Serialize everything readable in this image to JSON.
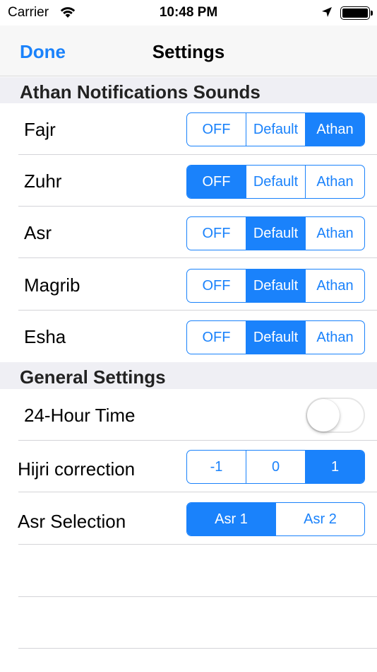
{
  "status_bar": {
    "carrier": "Carrier",
    "time": "10:48 PM",
    "icons": [
      "wifi-icon",
      "location-arrow-icon",
      "battery-icon"
    ]
  },
  "nav": {
    "done_label": "Done",
    "title": "Settings"
  },
  "sections": {
    "athan": {
      "header": "Athan Notifications Sounds",
      "options": [
        "OFF",
        "Default",
        "Athan"
      ],
      "rows": [
        {
          "label": "Fajr",
          "selected": "Athan"
        },
        {
          "label": "Zuhr",
          "selected": "OFF"
        },
        {
          "label": "Asr",
          "selected": "Default"
        },
        {
          "label": "Magrib",
          "selected": "Default"
        },
        {
          "label": "Esha",
          "selected": "Default"
        }
      ]
    },
    "general": {
      "header": "General Settings",
      "time_24h": {
        "label": "24-Hour Time",
        "on": false
      },
      "hijri": {
        "label": "Hijri correction",
        "options": [
          "-1",
          "0",
          "1"
        ],
        "selected": "1"
      },
      "asr_selection": {
        "label": "Asr Selection",
        "options": [
          "Asr 1",
          "Asr 2"
        ],
        "selected": "Asr 1"
      }
    }
  },
  "colors": {
    "accent": "#1a82fb",
    "section_bg": "#efeff4",
    "nav_bg": "#f7f7f7"
  }
}
